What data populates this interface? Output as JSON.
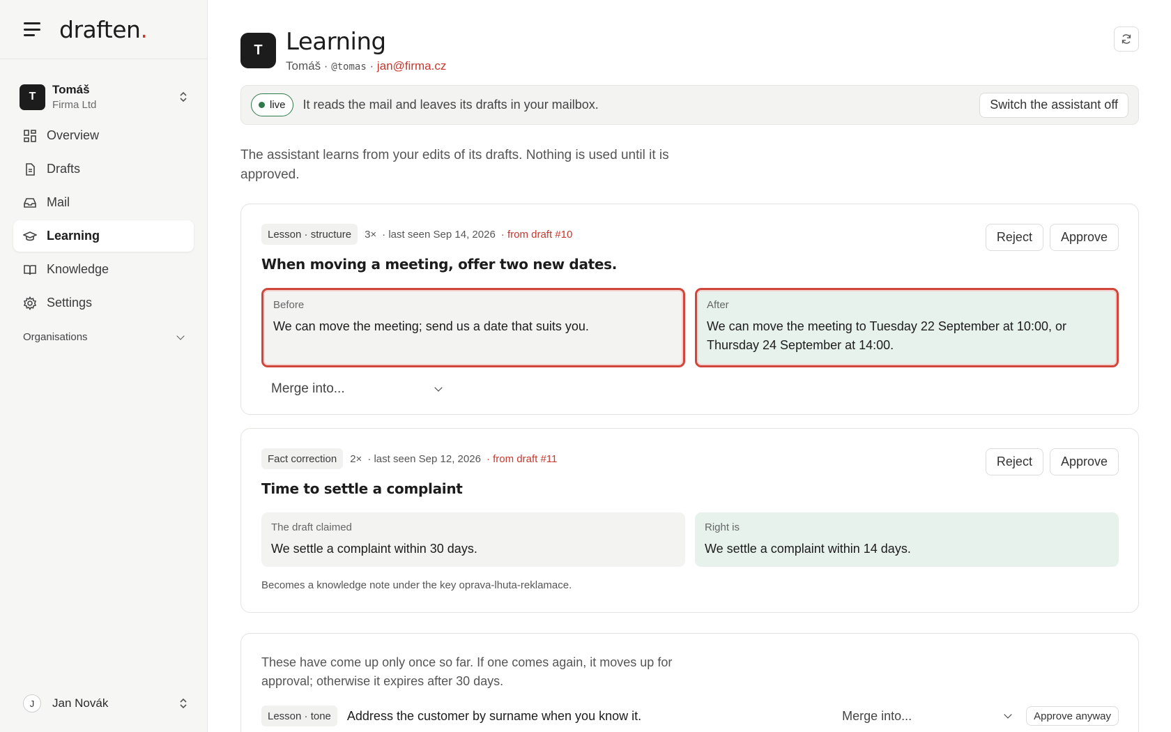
{
  "brand": {
    "name": "draften",
    "dot": "."
  },
  "account": {
    "initial": "T",
    "name": "Tomáš",
    "org": "Firma Ltd"
  },
  "nav": [
    {
      "label": "Overview",
      "icon": "grid-icon"
    },
    {
      "label": "Drafts",
      "icon": "document-icon"
    },
    {
      "label": "Mail",
      "icon": "inbox-icon"
    },
    {
      "label": "Learning",
      "icon": "graduation-cap-icon",
      "active": true
    },
    {
      "label": "Knowledge",
      "icon": "book-icon"
    },
    {
      "label": "Settings",
      "icon": "gear-icon"
    }
  ],
  "organisations_label": "Organisations",
  "user": {
    "initial": "J",
    "name": "Jan Novák"
  },
  "header": {
    "initial": "T",
    "title": "Learning",
    "name": "Tomáš",
    "sep": " · ",
    "handle": "@tomas",
    "email": "jan@firma.cz"
  },
  "status": {
    "badge": "live",
    "text": "It reads the mail and leaves its drafts in your mailbox.",
    "switch_label": "Switch the assistant off"
  },
  "intro": "The assistant learns from your edits of its drafts. Nothing is used until it is approved.",
  "lessons": [
    {
      "tag": "Lesson · structure",
      "count": "3×",
      "seen": "· last seen Sep 14, 2026",
      "from": "· from draft #10",
      "title": "When moving a meeting, offer two new dates.",
      "left_label": "Before",
      "left_text": "We can move the meeting; send us a date that suits you.",
      "right_label": "After",
      "right_text": "We can move the meeting to Tuesday 22 September at 10:00, or Thursday 24 September at 14:00.",
      "merge_label": "Merge into...",
      "reject_label": "Reject",
      "approve_label": "Approve"
    },
    {
      "tag": "Fact correction",
      "count": "2×",
      "seen": "· last seen Sep 12, 2026",
      "from": "· from draft #11",
      "title": "Time to settle a complaint",
      "left_label": "The draft claimed",
      "left_text": "We settle a complaint within 30 days.",
      "right_label": "Right is",
      "right_text": "We settle a complaint within 14 days.",
      "note": "Becomes a knowledge note under the key oprava-lhuta-reklamace.",
      "reject_label": "Reject",
      "approve_label": "Approve"
    }
  ],
  "pending": {
    "text": "These have come up only once so far. If one comes again, it moves up for approval; otherwise it expires after 30 days.",
    "items": [
      {
        "tag": "Lesson · tone",
        "text": "Address the customer by surname when you know it.",
        "merge_label": "Merge into...",
        "approve_label": "Approve anyway"
      }
    ]
  },
  "colors": {
    "accent": "#c8372d",
    "live": "#2f7a4a",
    "after_bg": "#e8f2ec",
    "highlight": "#d0463b"
  }
}
